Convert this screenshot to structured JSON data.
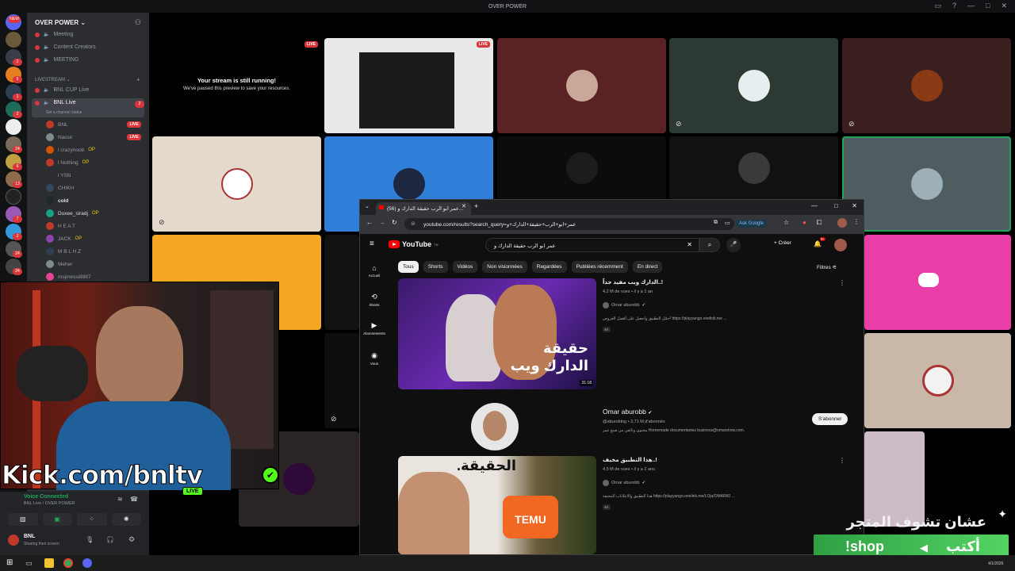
{
  "window": {
    "title": "OVER POWER"
  },
  "rail": {
    "badges": [
      "NEW",
      "2",
      "5",
      "1",
      "2",
      "24",
      "6",
      "1",
      "13",
      "1",
      "7",
      "2",
      "24",
      "24"
    ]
  },
  "sidebar": {
    "server_name": "OVER POWER",
    "channels_top": [
      {
        "label": "Meeting"
      },
      {
        "label": "Content Creators"
      },
      {
        "label": "MEETING"
      }
    ],
    "category_livestream": "LIVESTREAM",
    "channel_cup": "BNL CUP Live",
    "channel_live": "BNL Live",
    "channel_live_badge": "2",
    "channel_status": "Set a channel status",
    "users": [
      {
        "name": "BNL",
        "live": "LIVE"
      },
      {
        "name": "Nassir",
        "live": "LIVE"
      },
      {
        "name": "l crazynoob",
        "tag": "OP"
      },
      {
        "name": "l Nothing",
        "tag": "OP"
      },
      {
        "name": "l YSN"
      },
      {
        "name": "CHIKH"
      },
      {
        "name": "cold"
      },
      {
        "name": "Duxee_siradj",
        "tag": "OP"
      },
      {
        "name": "H E A T"
      },
      {
        "name": "JACK",
        "tag": "OP"
      },
      {
        "name": "M B L H Z"
      },
      {
        "name": "Meher"
      },
      {
        "name": "msjmessi8987"
      }
    ]
  },
  "voice": {
    "status": "Voice Connected",
    "location": "BNL Live / OVER POWER",
    "username": "BNL",
    "substatus": "Sharing their screen"
  },
  "stream_tile": {
    "live": "LIVE",
    "headline": "Your stream is still running!",
    "subline": "We've paused this preview to save your resources."
  },
  "browser": {
    "tab_title": "(56) عمر ابو الرب حقيقة الدارك و...",
    "url": "youtube.com/results?search_query=عمر+ابو+الرب+حقيقة+الدارك+و",
    "ask_google": "Ask Google"
  },
  "youtube": {
    "logo": "YouTube",
    "logo_region": "TN",
    "search_value": "عمر ابو الرب حقيقة الدارك و",
    "create": "Créer",
    "bell_badge": "9+",
    "side": [
      "Accueil",
      "Shorts",
      "Abonnements",
      "Vous"
    ],
    "chips": [
      "Tous",
      "Shorts",
      "Vidéos",
      "Non visionnées",
      "Regardées",
      "Publiées récemment",
      "En direct"
    ],
    "filters": "Filtres",
    "video1": {
      "title": "!..الدارك ويب مفيد جداً",
      "meta": "4,2 M de vues • il y a 1 an",
      "channel": "Omar aburobb",
      "desc": "حمّل التطبيق واحصل على أفضل العروض! https://playyango.onelink.me ...",
      "badge": "4K",
      "duration": "31:18",
      "thumb_text1": "حقيقة",
      "thumb_text2": "الدارك ويب"
    },
    "channel_card": {
      "name": "Omar aburobb",
      "handle_subs": "@aburobing • 3,71 M d'abonnés",
      "desc": "محتوى وثائقي من صنع عمر Homemade documentaries business@omarshow.com.",
      "subscribe": "S'abonner"
    },
    "video2": {
      "title": "!..هذا التطبيق مخيف",
      "meta": "4,5 M de vues • il y a 2 ans",
      "channel": "Omar aburobb",
      "desc": "هذا التطبيق والاعلانات المخيفة https://playyango.onelink.me/LOja/OMAR60 ...",
      "badge": "4K",
      "thumb_text1": "الحقيقة.",
      "thumb_text2": "TEMU"
    }
  },
  "overlay": {
    "kick": "Kick.com/bnltv",
    "kick_live": "LIVE",
    "shop_line1": "عشان تشوف المتجر",
    "shop_write": "أكتب",
    "shop_cmd": "!shop"
  },
  "taskbar": {
    "date": "4/1/2026"
  },
  "colors": {
    "discord_red": "#da373c",
    "discord_bg": "#2b2d31",
    "youtube_red": "#ff0000",
    "kick_green": "#53fc18",
    "shop_green": "#3bbf4e"
  }
}
